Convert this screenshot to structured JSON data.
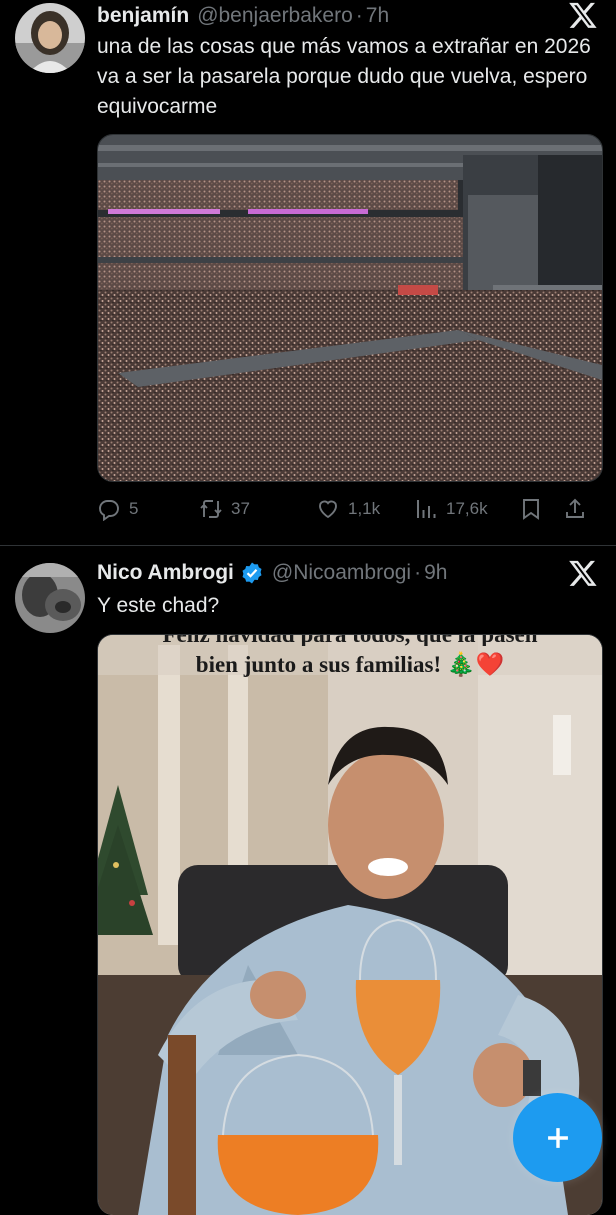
{
  "tweets": [
    {
      "name": "benjamín",
      "handle": "@benjaerbakero",
      "sep": "·",
      "time": "7h",
      "text": "una de las cosas que más vamos a extrañar en 2026 va a ser la pasarela porque dudo que vuelva, espero equivocarme",
      "stats": {
        "replies": "5",
        "reposts": "37",
        "likes": "1,1k",
        "views": "17,6k"
      }
    },
    {
      "name": "Nico Ambrogi",
      "verified": true,
      "handle": "@Nicoambrogi",
      "sep": "·",
      "time": "9h",
      "text": "Y este chad?",
      "image_caption_top": "Feliz navidad para todos, que la pasen",
      "image_caption": "bien junto a sus familias! 🎄❤️"
    }
  ],
  "colors": {
    "accent": "#1d9bf0",
    "muted": "#71767b",
    "text": "#e7e9ea",
    "border": "#2f3336"
  },
  "icons": [
    "x-logo-icon",
    "reply-icon",
    "repost-icon",
    "like-icon",
    "views-icon",
    "bookmark-icon",
    "share-icon",
    "verified-badge-icon",
    "plus-icon"
  ]
}
